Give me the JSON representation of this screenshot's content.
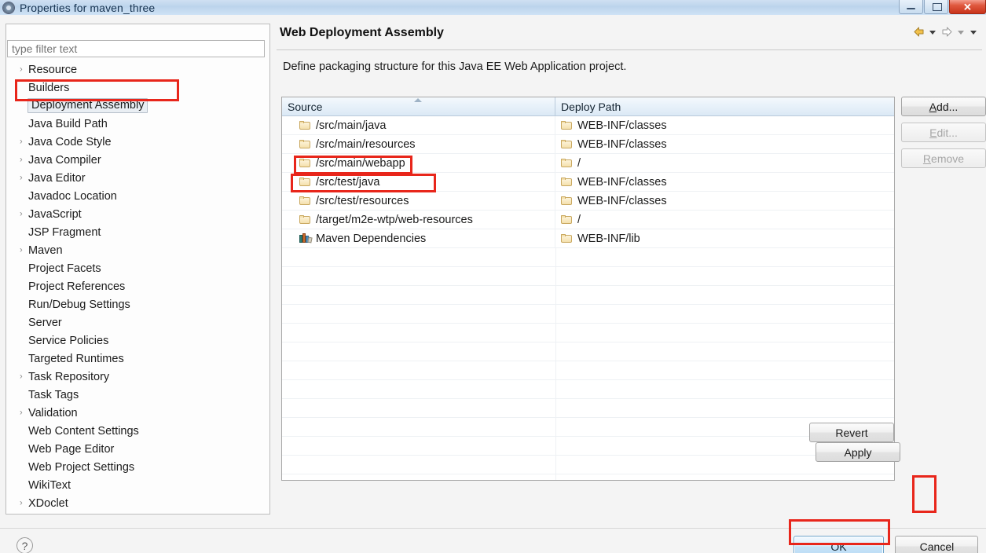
{
  "window": {
    "title": "Properties for maven_three",
    "icon": "properties-gear-icon",
    "minimize_label": "Minimize",
    "maximize_label": "Maximize",
    "close_label": "Close"
  },
  "filter": {
    "placeholder": "type filter text",
    "value": ""
  },
  "tree": {
    "items": [
      {
        "label": "Resource",
        "expandable": true,
        "selected": false
      },
      {
        "label": "Builders",
        "expandable": false,
        "selected": false
      },
      {
        "label": "Deployment Assembly",
        "expandable": false,
        "selected": true
      },
      {
        "label": "Java Build Path",
        "expandable": false,
        "selected": false
      },
      {
        "label": "Java Code Style",
        "expandable": true,
        "selected": false
      },
      {
        "label": "Java Compiler",
        "expandable": true,
        "selected": false
      },
      {
        "label": "Java Editor",
        "expandable": true,
        "selected": false
      },
      {
        "label": "Javadoc Location",
        "expandable": false,
        "selected": false
      },
      {
        "label": "JavaScript",
        "expandable": true,
        "selected": false
      },
      {
        "label": "JSP Fragment",
        "expandable": false,
        "selected": false
      },
      {
        "label": "Maven",
        "expandable": true,
        "selected": false
      },
      {
        "label": "Project Facets",
        "expandable": false,
        "selected": false
      },
      {
        "label": "Project References",
        "expandable": false,
        "selected": false
      },
      {
        "label": "Run/Debug Settings",
        "expandable": false,
        "selected": false
      },
      {
        "label": "Server",
        "expandable": false,
        "selected": false
      },
      {
        "label": "Service Policies",
        "expandable": false,
        "selected": false
      },
      {
        "label": "Targeted Runtimes",
        "expandable": false,
        "selected": false
      },
      {
        "label": "Task Repository",
        "expandable": true,
        "selected": false
      },
      {
        "label": "Task Tags",
        "expandable": false,
        "selected": false
      },
      {
        "label": "Validation",
        "expandable": true,
        "selected": false
      },
      {
        "label": "Web Content Settings",
        "expandable": false,
        "selected": false
      },
      {
        "label": "Web Page Editor",
        "expandable": false,
        "selected": false
      },
      {
        "label": "Web Project Settings",
        "expandable": false,
        "selected": false
      },
      {
        "label": "WikiText",
        "expandable": false,
        "selected": false
      },
      {
        "label": "XDoclet",
        "expandable": true,
        "selected": false
      }
    ]
  },
  "page": {
    "title": "Web Deployment Assembly",
    "description": "Define packaging structure for this Java EE Web Application project."
  },
  "nav": {
    "back_label": "Back",
    "back_menu_label": "Back history",
    "forward_label": "Forward",
    "forward_menu_label": "Forward history",
    "view_menu_label": "View menu"
  },
  "table": {
    "columns": [
      "Source",
      "Deploy Path"
    ],
    "sort_column": "Source",
    "sort_direction": "ascending",
    "rows": [
      {
        "source": "/src/main/java",
        "source_icon": "folder-icon",
        "deploy": "WEB-INF/classes",
        "deploy_icon": "folder-icon",
        "highlighted": false
      },
      {
        "source": "/src/main/resources",
        "source_icon": "folder-icon",
        "deploy": "WEB-INF/classes",
        "deploy_icon": "folder-icon",
        "highlighted": false
      },
      {
        "source": "/src/main/webapp",
        "source_icon": "folder-icon",
        "deploy": "/",
        "deploy_icon": "folder-icon",
        "highlighted": false
      },
      {
        "source": "/src/test/java",
        "source_icon": "folder-icon",
        "deploy": "WEB-INF/classes",
        "deploy_icon": "folder-icon",
        "highlighted": true
      },
      {
        "source": "/src/test/resources",
        "source_icon": "folder-icon",
        "deploy": "WEB-INF/classes",
        "deploy_icon": "folder-icon",
        "highlighted": true
      },
      {
        "source": "/target/m2e-wtp/web-resources",
        "source_icon": "folder-icon",
        "deploy": "/",
        "deploy_icon": "folder-icon",
        "highlighted": false
      },
      {
        "source": "Maven Dependencies",
        "source_icon": "library-icon",
        "deploy": "WEB-INF/lib",
        "deploy_icon": "folder-icon",
        "highlighted": false
      }
    ],
    "empty_row_count": 14
  },
  "side_buttons": [
    {
      "label": "Add...",
      "mnemonic": "A",
      "enabled": true,
      "name": "add-button"
    },
    {
      "label": "Edit...",
      "mnemonic": "E",
      "enabled": false,
      "name": "edit-button"
    },
    {
      "label": "Remove",
      "mnemonic": "R",
      "enabled": false,
      "name": "remove-button"
    }
  ],
  "low_buttons": [
    {
      "label": "Revert",
      "mnemonic": "v",
      "name": "revert-button"
    },
    {
      "label": "Apply",
      "mnemonic": "A",
      "name": "apply-button"
    }
  ],
  "footer": {
    "help_label": "?",
    "ok_label": "OK",
    "cancel_label": "Cancel"
  },
  "colors": {
    "annotation": "#e8261b",
    "title_bar": "#bcd4ec",
    "close_button": "#c8331b",
    "ok_focus": "#c6e3f8"
  },
  "annotations": [
    {
      "target": "sidebar-item-deployment-assembly"
    },
    {
      "target": "table-row-src-test-java"
    },
    {
      "target": "table-row-src-test-resources"
    },
    {
      "target": "apply-button"
    },
    {
      "target": "ok-button"
    }
  ]
}
